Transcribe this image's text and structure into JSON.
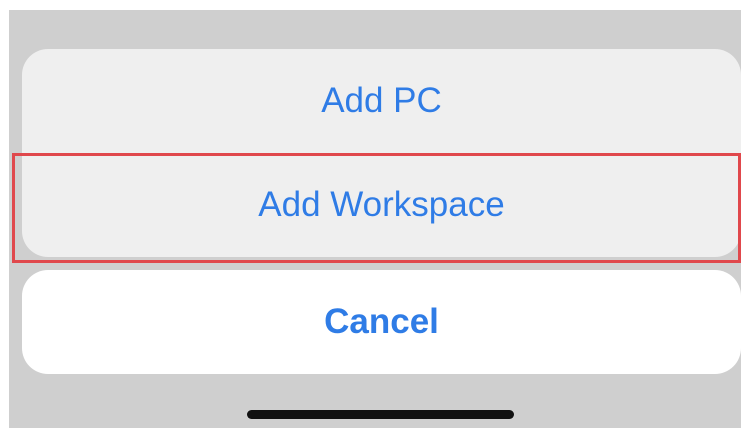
{
  "action_sheet": {
    "items": [
      {
        "label": "Add PC"
      },
      {
        "label": "Add Workspace"
      }
    ],
    "highlighted_item": "Add Workspace",
    "cancel_label": "Cancel"
  },
  "colors": {
    "accent": "#2f7ce6",
    "highlight_border": "#e0484c",
    "sheet_background": "#efefef",
    "backdrop": "#cfcfcf"
  }
}
